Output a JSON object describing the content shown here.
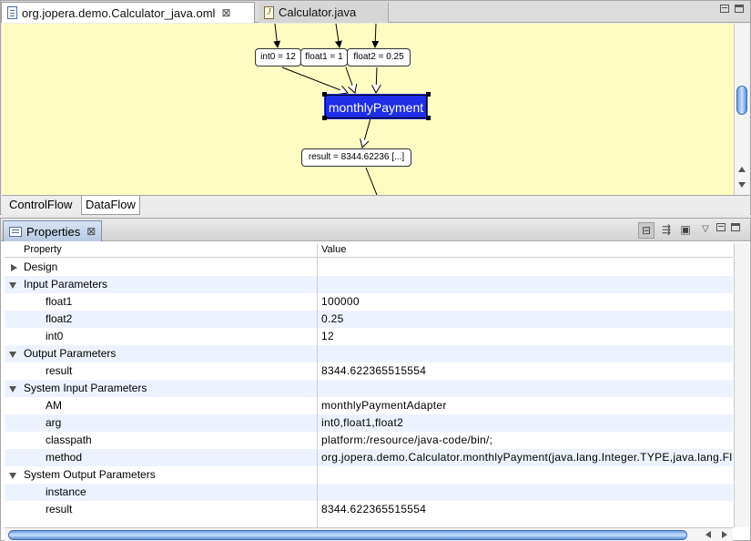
{
  "editor": {
    "tabs": [
      {
        "label": "org.jopera.demo.Calculator_java.oml",
        "icon": "oml-file-icon",
        "active": true
      },
      {
        "label": "Calculator.java",
        "icon": "java-file-icon",
        "active": false
      }
    ],
    "close_glyph": "⊠"
  },
  "canvas": {
    "background": "#fdfdc3",
    "nodes": {
      "int0": "int0 = 12",
      "float1": "float1 = 1",
      "float2": "float2 = 0.25",
      "task": "monthlyPayment",
      "result": "result = 8344.62236 [...]"
    },
    "task_color": "#1f2ee8"
  },
  "flow_tabs": [
    "ControlFlow",
    "DataFlow"
  ],
  "properties": {
    "title": "Properties",
    "close_glyph": "⊠",
    "columns": {
      "property": "Property",
      "value": "Value"
    },
    "rows": [
      {
        "label": "Design",
        "value": "",
        "level": 0,
        "expander": "collapsed"
      },
      {
        "label": "Input Parameters",
        "value": "",
        "level": 0,
        "expander": "expanded"
      },
      {
        "label": "float1",
        "value": "100000",
        "level": 1
      },
      {
        "label": "float2",
        "value": "0.25",
        "level": 1
      },
      {
        "label": "int0",
        "value": "12",
        "level": 1
      },
      {
        "label": "Output Parameters",
        "value": "",
        "level": 0,
        "expander": "expanded"
      },
      {
        "label": "result",
        "value": "8344.622365515554",
        "level": 1
      },
      {
        "label": "System Input Parameters",
        "value": "",
        "level": 0,
        "expander": "expanded"
      },
      {
        "label": "AM",
        "value": "monthlyPaymentAdapter",
        "level": 1
      },
      {
        "label": "arg",
        "value": "int0,float1,float2",
        "level": 1
      },
      {
        "label": "classpath",
        "value": "platform:/resource/java-code/bin/;",
        "level": 1
      },
      {
        "label": "method",
        "value": "org.jopera.demo.Calculator.monthlyPayment(java.lang.Integer.TYPE,java.lang.Flo",
        "level": 1
      },
      {
        "label": "System Output Parameters",
        "value": "",
        "level": 0,
        "expander": "expanded"
      },
      {
        "label": "instance",
        "value": "",
        "level": 1
      },
      {
        "label": "result",
        "value": "8344.622365515554",
        "level": 1
      }
    ]
  }
}
